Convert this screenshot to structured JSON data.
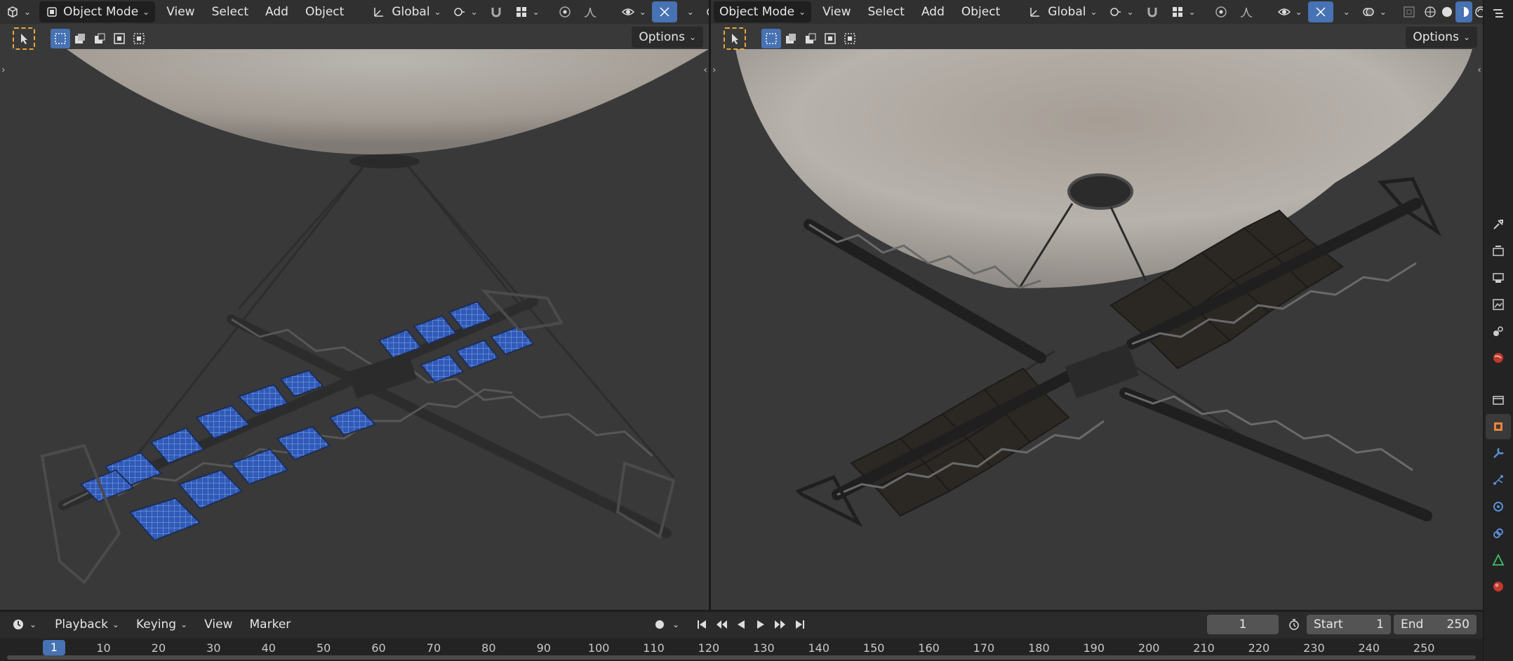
{
  "viewport_left": {
    "mode": "Object Mode",
    "menus": [
      "View",
      "Select",
      "Add",
      "Object"
    ],
    "transform_orientation": "Global",
    "options_label": "Options"
  },
  "viewport_right": {
    "mode": "Object Mode",
    "menus": [
      "View",
      "Select",
      "Add",
      "Object"
    ],
    "transform_orientation": "Global",
    "options_label": "Options"
  },
  "timeline": {
    "menus": [
      "Playback",
      "Keying",
      "View",
      "Marker"
    ],
    "current_frame": "1",
    "start_label": "Start",
    "start_value": "1",
    "end_label": "End",
    "end_value": "250",
    "ruler_current": "1",
    "ruler_ticks": [
      "10",
      "20",
      "30",
      "40",
      "50",
      "60",
      "70",
      "80",
      "90",
      "100",
      "110",
      "120",
      "130",
      "140",
      "150",
      "160",
      "170",
      "180",
      "190",
      "200",
      "210",
      "220",
      "230",
      "240",
      "250"
    ]
  },
  "colors": {
    "accent": "#4772b3",
    "header_bg": "#303030",
    "viewport_bg": "#393939",
    "select_tool_outline": "#e8a53a"
  },
  "icons": {
    "editor_type": "3d-viewport-icon",
    "timeline_editor": "clock-icon",
    "properties_tabs": [
      "tool-icon",
      "render-icon",
      "output-icon",
      "view-layer-icon",
      "scene-icon",
      "world-icon",
      "collection-icon",
      "object-icon",
      "modifier-icon",
      "particles-icon",
      "physics-icon",
      "constraints-icon",
      "data-icon",
      "material-icon"
    ]
  }
}
